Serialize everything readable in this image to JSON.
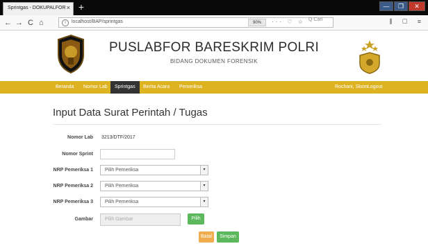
{
  "browser": {
    "tab_title": "Sprintgas - DOKUPALFOR",
    "tab_close": "×",
    "new_tab": "+",
    "url": "localhost/BAP/sprintgas",
    "zoom": "90%",
    "url_icons": "··· ♡ ☆",
    "search_placeholder": "Q Cari",
    "right_icons": "⫼ ▢ ≡",
    "nav_back": "←",
    "nav_forward": "→",
    "nav_reload": "C",
    "nav_home": "⌂",
    "win_minimize": "—",
    "win_maximize": "❐",
    "win_close": "✕"
  },
  "header": {
    "title": "PUSLABFOR BARESKRIM POLRI",
    "subtitle": "BIDANG DOKUMEN FORENSIK"
  },
  "menu": {
    "items": [
      "Beranda",
      "Nomor Lab",
      "Sprintgas",
      "Berita Acara",
      "Pemeriksa"
    ],
    "user": "Rochani, Skom",
    "logout": "Logout"
  },
  "form": {
    "title": "Input Data Surat Perintah / Tugas",
    "nomor_lab_label": "Nomor Lab",
    "nomor_lab_value": "3213/DTF/2017",
    "nomor_sprint_label": "Nomor Sprint",
    "nomor_sprint_value": "",
    "nrp1_label": "NRP Pemeriksa 1",
    "nrp1_value": "Pilih Pemeriksa",
    "nrp2_label": "NRP Pemeriksa 2",
    "nrp2_value": "Pilih Pemeriksa",
    "nrp3_label": "NRP Pemeriksa 3",
    "nrp3_value": "Pilih Pemeriksa",
    "gambar_label": "Gambar",
    "gambar_placeholder": "Pilih Gambar",
    "pilih_button": "Pilih",
    "batal_button": "Batal",
    "simpan_button": "Simpan"
  },
  "colors": {
    "menu_bg": "#ddb322",
    "menu_active": "#333333",
    "btn_green": "#5cb85c",
    "btn_orange": "#f0ad4e"
  }
}
